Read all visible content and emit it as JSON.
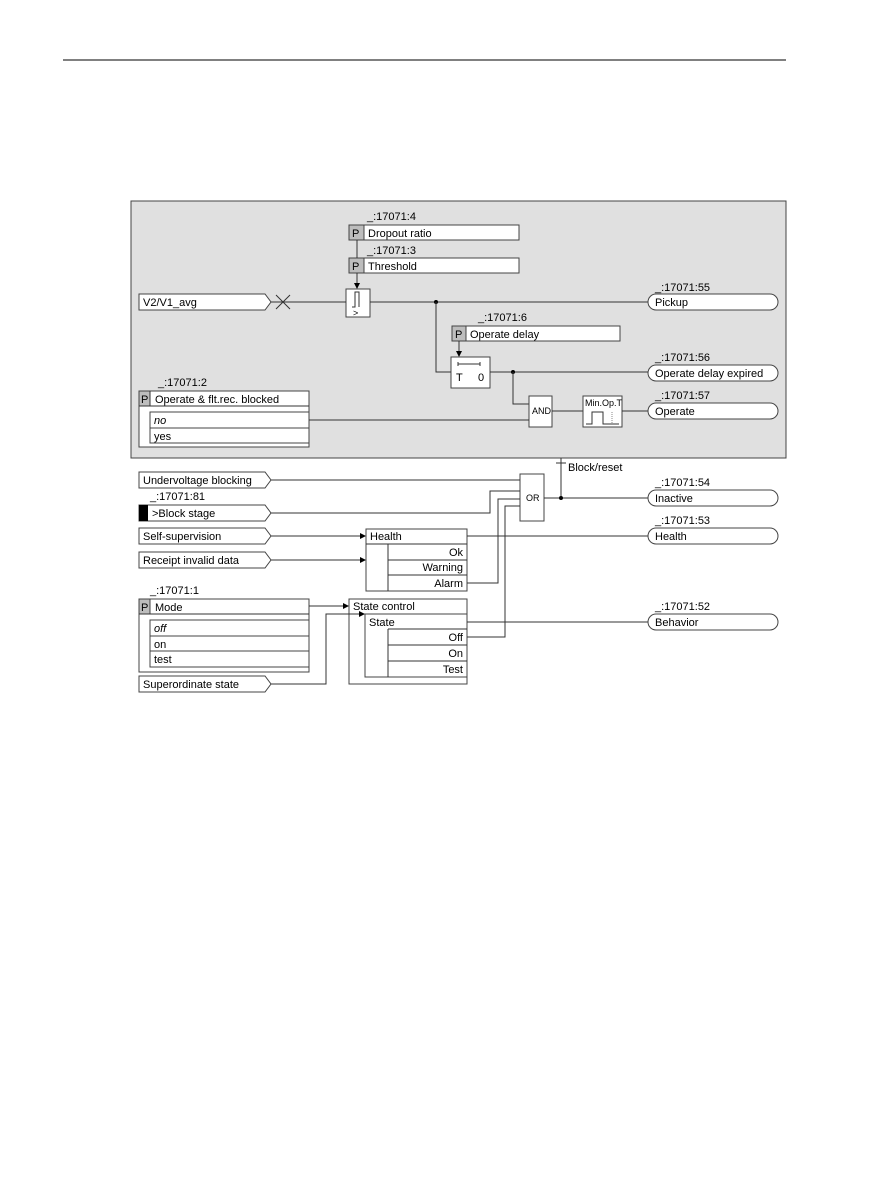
{
  "diagram": {
    "colors": {
      "panel": "#e0e0e0",
      "param_cell": "#bdbdbd",
      "line": "#333333"
    },
    "param_marker": "P",
    "dropout_ratio": {
      "id": "_:17071:4",
      "label": "Dropout ratio"
    },
    "threshold": {
      "id": "_:17071:3",
      "label": "Threshold"
    },
    "comparator_symbol": ">",
    "input_v2v1": "V2/V1_avg",
    "pickup": {
      "id": "_:17071:55",
      "label": "Pickup"
    },
    "operate_delay": {
      "id": "_:17071:6",
      "label": "Operate delay"
    },
    "timer": {
      "t": "T",
      "zero": "0"
    },
    "operate_delay_expired": {
      "id": "_:17071:56",
      "label": "Operate delay expired"
    },
    "and_gate": "AND",
    "min_op_t": "Min.Op.T",
    "operate": {
      "id": "_:17071:57",
      "label": "Operate"
    },
    "operate_blocked": {
      "id": "_:17071:2",
      "label": "Operate & flt.rec. blocked",
      "options": [
        "no",
        "yes"
      ]
    },
    "block_reset": "Block/reset",
    "or_gate": "OR",
    "undervoltage_blocking": "Undervoltage blocking",
    "block_stage": {
      "id": "_:17071:81",
      "label": ">Block stage"
    },
    "inactive": {
      "id": "_:17071:54",
      "label": "Inactive"
    },
    "self_supervision": "Self-supervision",
    "receipt_invalid": "Receipt invalid data",
    "health_block": {
      "title": "Health",
      "rows": [
        "Ok",
        "Warning",
        "Alarm"
      ]
    },
    "health_out": {
      "id": "_:17071:53",
      "label": "Health"
    },
    "mode": {
      "id": "_:17071:1",
      "label": "Mode",
      "options": [
        "off",
        "on",
        "test"
      ]
    },
    "state_control": {
      "title": "State control",
      "state": "State",
      "rows": [
        "Off",
        "On",
        "Test"
      ]
    },
    "behavior": {
      "id": "_:17071:52",
      "label": "Behavior"
    },
    "superordinate_state": "Superordinate state"
  }
}
